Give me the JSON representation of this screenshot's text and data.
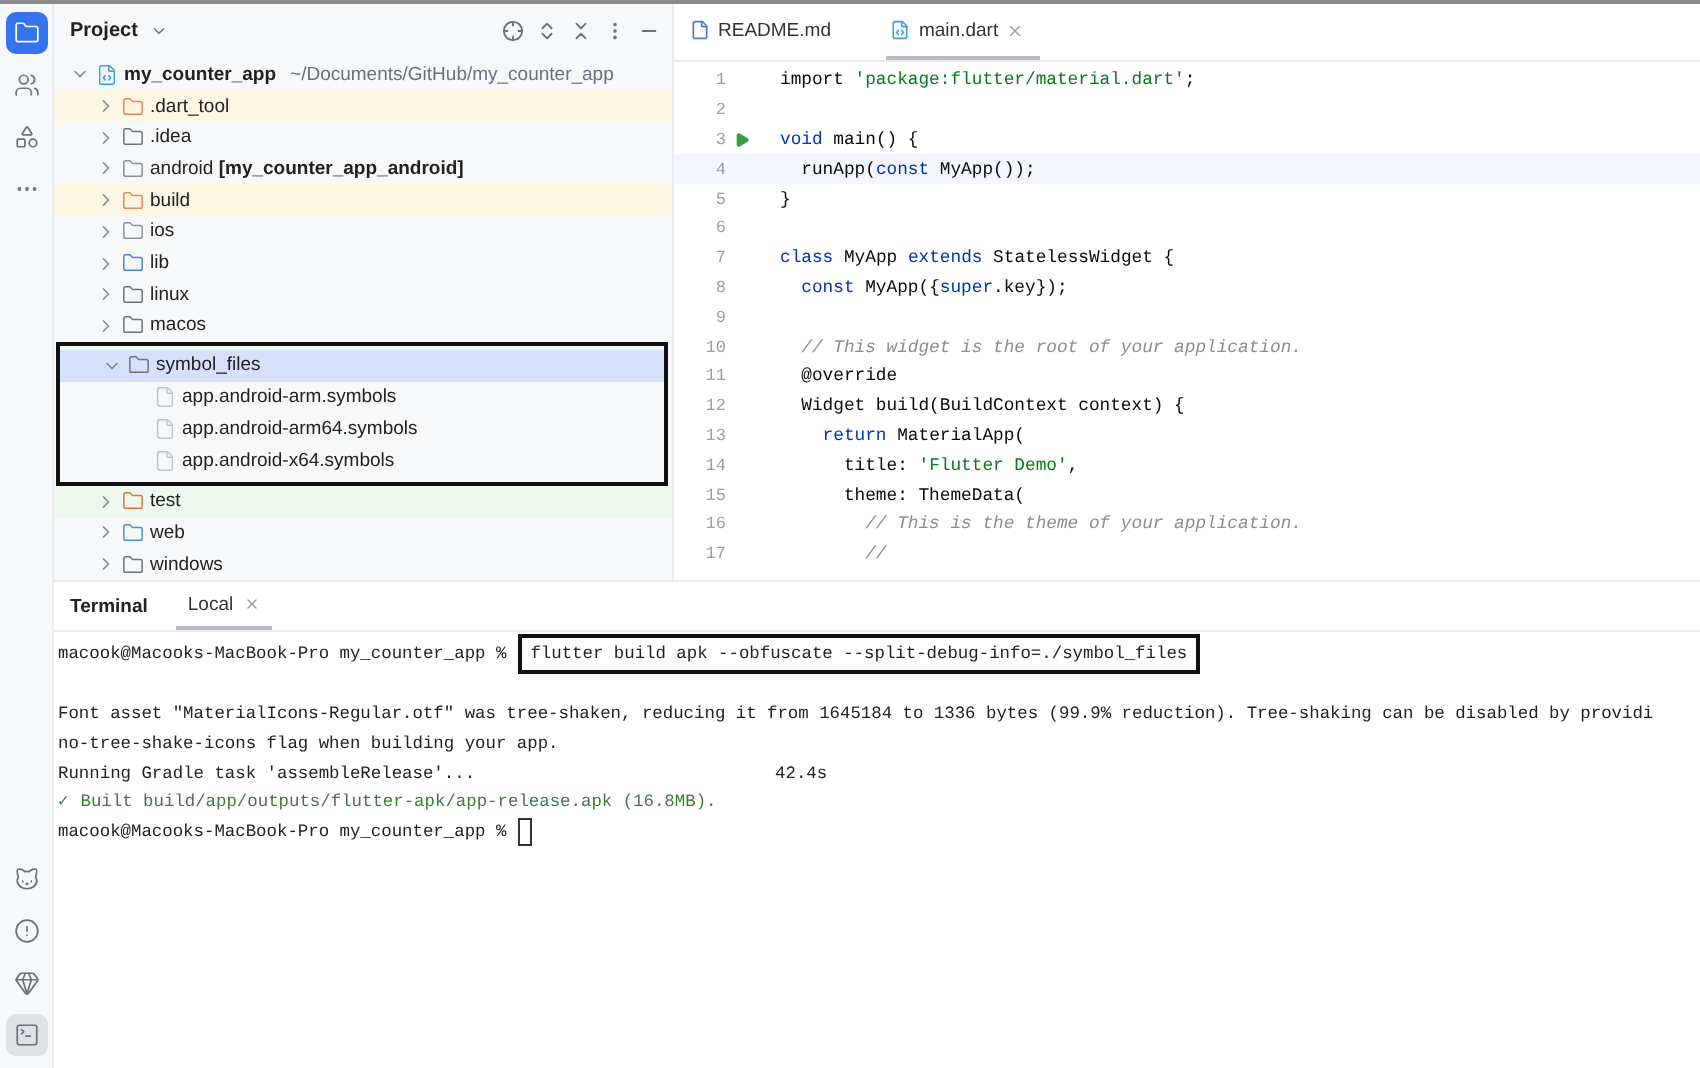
{
  "tool_strip": {
    "top_icons": [
      {
        "kind": "project",
        "selected": true
      },
      {
        "kind": "people",
        "selected": false
      },
      {
        "kind": "structure",
        "selected": false
      },
      {
        "kind": "more",
        "selected": false
      }
    ],
    "bottom_icons": [
      {
        "kind": "cat",
        "selected": false
      },
      {
        "kind": "problems",
        "selected": false
      },
      {
        "kind": "gem",
        "selected": false
      },
      {
        "kind": "terminal",
        "selected": true
      }
    ]
  },
  "project_panel": {
    "title": "Project",
    "tree": {
      "name": "my_counter_app",
      "path": "~/Documents/GitHub/my_counter_app",
      "kind": "root",
      "expanded": true,
      "selected": false,
      "children": [
        {
          "name": ".dart_tool",
          "kind": "excluded",
          "expanded": false,
          "selected": false
        },
        {
          "name": ".idea",
          "kind": "config",
          "expanded": false,
          "selected": false
        },
        {
          "name": "android **[my_counter_app_android]**",
          "kind": "module",
          "expanded": false,
          "selected": false
        },
        {
          "name": "build",
          "kind": "excluded",
          "expanded": false,
          "selected": false
        },
        {
          "name": "ios",
          "kind": "module",
          "expanded": false,
          "selected": false
        },
        {
          "name": "lib",
          "kind": "source",
          "expanded": false,
          "selected": false
        },
        {
          "name": "linux",
          "kind": "plain",
          "expanded": false,
          "selected": false
        },
        {
          "name": "macos",
          "kind": "plain",
          "expanded": false,
          "selected": false
        },
        {
          "name": "symbol_files",
          "kind": "plain",
          "expanded": true,
          "selected": true,
          "annotated": true,
          "children": [
            {
              "name": "app.android-arm.symbols",
              "kind": "file",
              "selected": false
            },
            {
              "name": "app.android-arm64.symbols",
              "kind": "file",
              "selected": false
            },
            {
              "name": "app.android-x64.symbols",
              "kind": "file",
              "selected": false
            }
          ]
        },
        {
          "name": "test",
          "kind": "test",
          "expanded": false,
          "selected": false
        },
        {
          "name": "web",
          "kind": "web",
          "expanded": false,
          "selected": false
        },
        {
          "name": "windows",
          "kind": "plain",
          "expanded": false,
          "selected": false
        }
      ]
    }
  },
  "editor": {
    "tabs": [
      {
        "label": "README.md",
        "kind": "markdown",
        "selected": false,
        "closable": false
      },
      {
        "label": "main.dart",
        "kind": "dart",
        "selected": true,
        "closable": true
      }
    ],
    "lines": [
      {
        "number": "1",
        "run": false,
        "current": false,
        "tokens": [
          {
            "kind": "plain",
            "text": "import "
          },
          {
            "kind": "string",
            "text": "'package:flutter/material.dart'"
          },
          {
            "kind": "plain",
            "text": ";"
          }
        ]
      },
      {
        "number": "2",
        "run": false,
        "current": false
      },
      {
        "number": "3",
        "run": true,
        "current": false,
        "tokens": [
          {
            "kind": "keyword",
            "text": "void "
          },
          {
            "kind": "plain",
            "text": "main() {"
          }
        ]
      },
      {
        "number": "4",
        "run": false,
        "current": true,
        "tokens": [
          {
            "kind": "plain",
            "text": "  runApp("
          },
          {
            "kind": "keyword",
            "text": "const "
          },
          {
            "kind": "plain",
            "text": "MyApp());"
          }
        ]
      },
      {
        "number": "5",
        "run": false,
        "current": false,
        "tokens": [
          {
            "kind": "plain",
            "text": "}"
          }
        ]
      },
      {
        "number": "6",
        "run": false,
        "current": false
      },
      {
        "number": "7",
        "run": false,
        "current": false,
        "tokens": [
          {
            "kind": "keyword",
            "text": "class "
          },
          {
            "kind": "plain",
            "text": "MyApp "
          },
          {
            "kind": "keyword",
            "text": "extends "
          },
          {
            "kind": "plain",
            "text": "StatelessWidget {"
          }
        ]
      },
      {
        "number": "8",
        "run": false,
        "current": false,
        "tokens": [
          {
            "kind": "keyword",
            "text": "  const "
          },
          {
            "kind": "plain",
            "text": "MyApp({"
          },
          {
            "kind": "keyword",
            "text": "super"
          },
          {
            "kind": "plain",
            "text": ".key});"
          }
        ]
      },
      {
        "number": "9",
        "run": false,
        "current": false
      },
      {
        "number": "10",
        "run": false,
        "current": false,
        "tokens": [
          {
            "kind": "comment",
            "text": "  // This widget is the root of your application."
          }
        ]
      },
      {
        "number": "11",
        "run": false,
        "current": false,
        "tokens": [
          {
            "kind": "plain",
            "text": "  @override"
          }
        ]
      },
      {
        "number": "12",
        "run": false,
        "current": false,
        "tokens": [
          {
            "kind": "plain",
            "text": "  Widget build(BuildContext context) {"
          }
        ]
      },
      {
        "number": "13",
        "run": false,
        "current": false,
        "tokens": [
          {
            "kind": "keyword",
            "text": "    return "
          },
          {
            "kind": "plain",
            "text": "MaterialApp("
          }
        ]
      },
      {
        "number": "14",
        "run": false,
        "current": false,
        "tokens": [
          {
            "kind": "plain",
            "text": "      title: "
          },
          {
            "kind": "string",
            "text": "'Flutter Demo'"
          },
          {
            "kind": "plain",
            "text": ","
          }
        ]
      },
      {
        "number": "15",
        "run": false,
        "current": false,
        "tokens": [
          {
            "kind": "plain",
            "text": "      theme: ThemeData("
          }
        ]
      },
      {
        "number": "16",
        "run": false,
        "current": false,
        "tokens": [
          {
            "kind": "comment",
            "text": "        // This is the theme of your application."
          }
        ]
      },
      {
        "number": "17",
        "run": false,
        "current": false,
        "tokens": [
          {
            "kind": "comment",
            "text": "        //"
          }
        ]
      }
    ]
  },
  "terminal": {
    "title": "Terminal",
    "tabs": [
      {
        "label": "Local",
        "selected": true
      }
    ],
    "lines": [
      {
        "kind": "prompt",
        "prompt": "macook@Macooks-MacBook-Pro my_counter_app %",
        "command": "flutter build apk --obfuscate --split-debug-info=./symbol_files",
        "annotated": true
      },
      {
        "kind": "blank"
      },
      {
        "kind": "output",
        "text": "Font asset \"MaterialIcons-Regular.otf\" was tree-shaken, reducing it from 1645184 to 1336 bytes (99.9% reduction). Tree-shaking can be disabled by providi"
      },
      {
        "kind": "output",
        "text": "no-tree-shake-icons flag when building your app."
      },
      {
        "kind": "progress",
        "text": "Running Gradle task 'assembleRelease'...",
        "time": "42.4s"
      },
      {
        "kind": "success",
        "mark": "✓",
        "text": "Built build/app/outputs/flutter-apk/app-release.apk (16.8MB)."
      },
      {
        "kind": "prompt",
        "prompt": "macook@Macooks-MacBook-Pro my_counter_app %",
        "cursor": true
      }
    ]
  }
}
